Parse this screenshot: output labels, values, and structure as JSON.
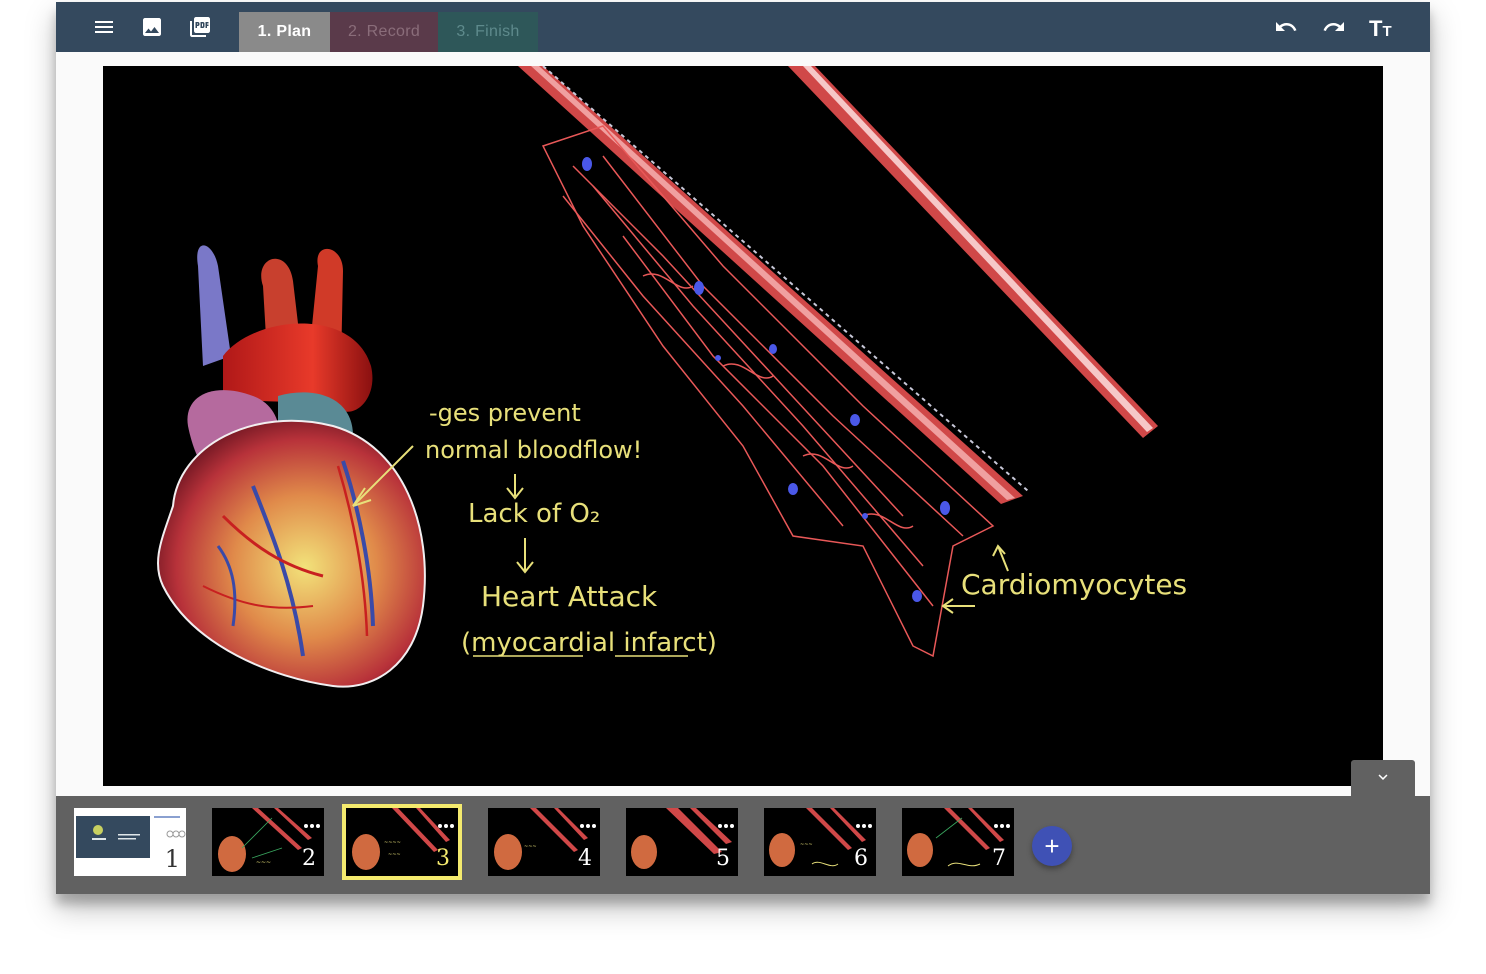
{
  "toolbar": {
    "icons": [
      "menu-icon",
      "image-icon",
      "pdf-icon",
      "undo-icon",
      "redo-icon",
      "text-size-icon"
    ],
    "steps": {
      "plan": "1. Plan",
      "record": "2. Record",
      "finish": "3. Finish"
    },
    "text_size_label": "Tt"
  },
  "slide": {
    "annotations": {
      "line1": "-ges prevent",
      "line2": "normal bloodflow!",
      "line3": "Lack of O₂",
      "line4": "Heart Attack",
      "line5": "(myocardial infarct)",
      "cells_label": "Cardiomyocytes"
    }
  },
  "filmstrip": {
    "slides": [
      {
        "number": "1"
      },
      {
        "number": "2"
      },
      {
        "number": "3"
      },
      {
        "number": "4"
      },
      {
        "number": "5"
      },
      {
        "number": "6"
      },
      {
        "number": "7"
      }
    ],
    "selected_slide": 3,
    "add_label": "+"
  },
  "colors": {
    "toolbar_bg": "#34495e",
    "step_active": "#8a8a8a",
    "step_record": "#5a3a4a",
    "step_finish": "#2e5759",
    "filmstrip_bg": "#616161",
    "selected_outline": "#f4ea6e",
    "add_button": "#3f51b5",
    "chalk_yellow": "#e8e07a",
    "vessel_red": "#e06060"
  }
}
